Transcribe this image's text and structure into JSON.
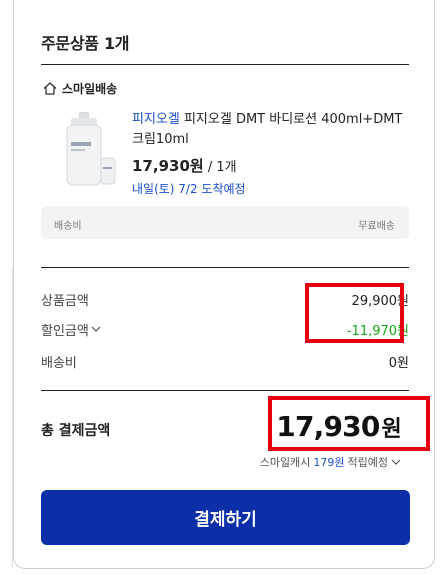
{
  "order": {
    "title": "주문상품 1개",
    "shipping_type": "스마일배송",
    "product": {
      "brand": "피지오겔",
      "name": " 피지오겔 DMT 바디로션 400ml+DMT크림10ml",
      "price": "17,930원",
      "qty": " / 1개",
      "arrival": "내일(토) 7/2 도착예정"
    },
    "shipping_box": {
      "label": "배송비",
      "value": "무료배송"
    }
  },
  "summary": {
    "product_amount_label": "상품금액",
    "product_amount": "29,900원",
    "discount_label": "할인금액",
    "discount_amount": "-11,970원",
    "shipping_label": "배송비",
    "shipping_amount": "0원",
    "total_label": "총 결제금액",
    "total_amount": "17,930",
    "total_unit": "원",
    "points_prefix": "스마일캐시",
    "points_amount": "179원",
    "points_suffix": "적립예정"
  },
  "pay_button": {
    "label": "결제하기"
  },
  "colors": {
    "accent": "#0a2fa8",
    "link": "#1a4fcf",
    "discount": "#17a817",
    "highlight": "#e60012"
  }
}
